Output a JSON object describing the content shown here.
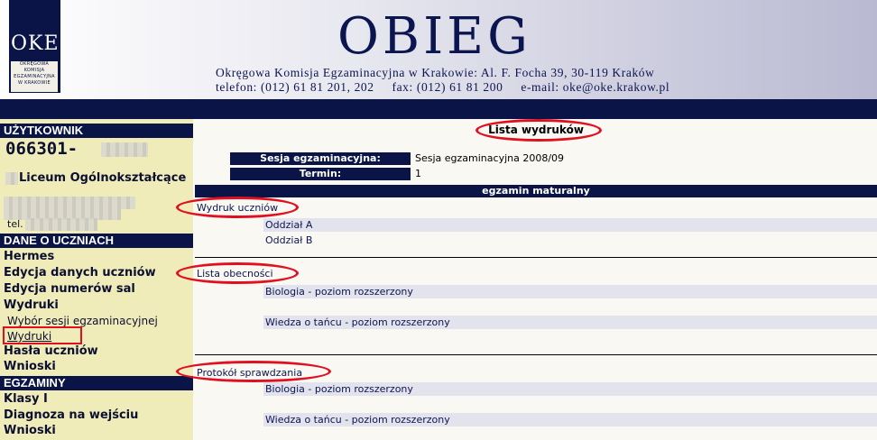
{
  "header": {
    "logo_mark": "OKE",
    "logo_lines": [
      "OKRĘGOWA",
      "KOMISJA",
      "EGZAMINACYJNA",
      "W KRAKOWIE"
    ],
    "title": "OBIEG",
    "address_line": "Okręgowa Komisja Egzaminacyjna w Krakowie: Al. F. Focha 39, 30-119 Kraków",
    "contact_line": "telefon: (012) 61 81 201, 202     fax: (012) 61 81 200     e-mail: oke@oke.krakow.pl"
  },
  "sidebar": {
    "user_heading": "UŻYTKOWNIK",
    "user_code": "066301-",
    "school_name": "Liceum Ogólnokształcące",
    "phone_label": "tel.",
    "students_heading": "DANE O UCZNIACH",
    "students_items": [
      "Hermes",
      "Edycja danych uczniów",
      "Edycja numerów sal",
      "Wydruki"
    ],
    "students_subitems": [
      "Wybór sesji egzaminacyjnej",
      "Wydruki"
    ],
    "students_items2": [
      "Hasła uczniów",
      "Wnioski"
    ],
    "exams_heading": "EGZAMINY",
    "exams_items": [
      "Klasy I",
      "Diagnoza na wejściu",
      "Wnioski"
    ]
  },
  "main": {
    "page_title": "Lista wydruków",
    "session_label": "Sesja egzaminacyjna:",
    "session_value": "Sesja egzaminacyjna 2008/09",
    "term_label": "Termin:",
    "term_value": "1",
    "exam_bar": "egzamin maturalny",
    "sections": [
      {
        "title": "Wydruk uczniów",
        "items": [
          "Oddział A",
          "Oddział B"
        ]
      },
      {
        "title": "Lista obecności",
        "items": [
          "Biologia - poziom rozszerzony",
          "",
          "Wiedza o tańcu - poziom rozszerzony"
        ]
      },
      {
        "title": "Protokół sprawdzania",
        "items": [
          "Biologia - poziom rozszerzony",
          "",
          "Wiedza o tańcu - poziom rozszerzony"
        ]
      }
    ]
  },
  "colors": {
    "navy": "#0a1446",
    "sidebar_bg": "#f0ecba",
    "row_bg": "#e3e3ee",
    "highlight_red": "#e01020"
  }
}
